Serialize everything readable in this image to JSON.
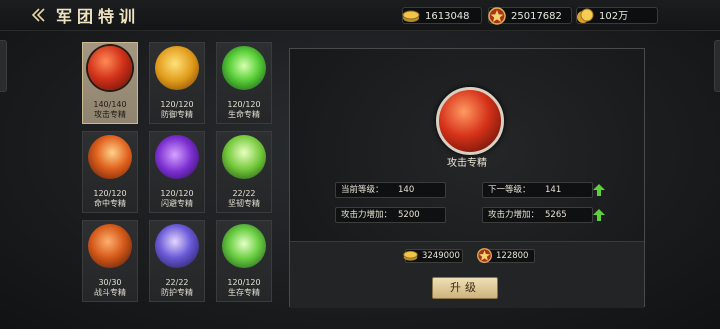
{
  "header": {
    "back_icon": "back-arrow-icon",
    "title": "军团特训"
  },
  "resources": [
    {
      "name": "coin",
      "icon": "coin-icon",
      "value": "1613048"
    },
    {
      "name": "medal",
      "icon": "star-medal-icon",
      "value": "25017682"
    },
    {
      "name": "gold",
      "icon": "gold-coin-icon",
      "value": "102万"
    }
  ],
  "skills": [
    {
      "progress": "140/140",
      "name": "攻击专精",
      "icon": "attack-orb-icon",
      "selected": true
    },
    {
      "progress": "120/120",
      "name": "防御专精",
      "icon": "shield-orb-icon"
    },
    {
      "progress": "120/120",
      "name": "生命专精",
      "icon": "life-orb-icon"
    },
    {
      "progress": "120/120",
      "name": "命中专精",
      "icon": "hit-orb-icon"
    },
    {
      "progress": "120/120",
      "name": "闪避专精",
      "icon": "dodge-orb-icon"
    },
    {
      "progress": "22/22",
      "name": "坚韧专精",
      "icon": "tenacity-orb-icon"
    },
    {
      "progress": "30/30",
      "name": "战斗专精",
      "icon": "battle-orb-icon"
    },
    {
      "progress": "22/22",
      "name": "防护专精",
      "icon": "protect-orb-icon"
    },
    {
      "progress": "120/120",
      "name": "生存专精",
      "icon": "survival-orb-icon"
    }
  ],
  "detail": {
    "skill_name": "攻击专精",
    "current_level_label": "当前等级：",
    "current_level": "140",
    "next_level_label": "下一等级：",
    "next_level": "141",
    "current_bonus_label": "攻击力增加：",
    "current_bonus": "5200",
    "next_bonus_label": "攻击力增加：",
    "next_bonus": "5265",
    "cost_coin": "3249000",
    "cost_medal": "122800",
    "upgrade_label": "升级"
  },
  "colors": {
    "accent_gold": "#cdb37d",
    "selected_cell": "#a49782",
    "up_arrow": "#5fcf3a"
  }
}
